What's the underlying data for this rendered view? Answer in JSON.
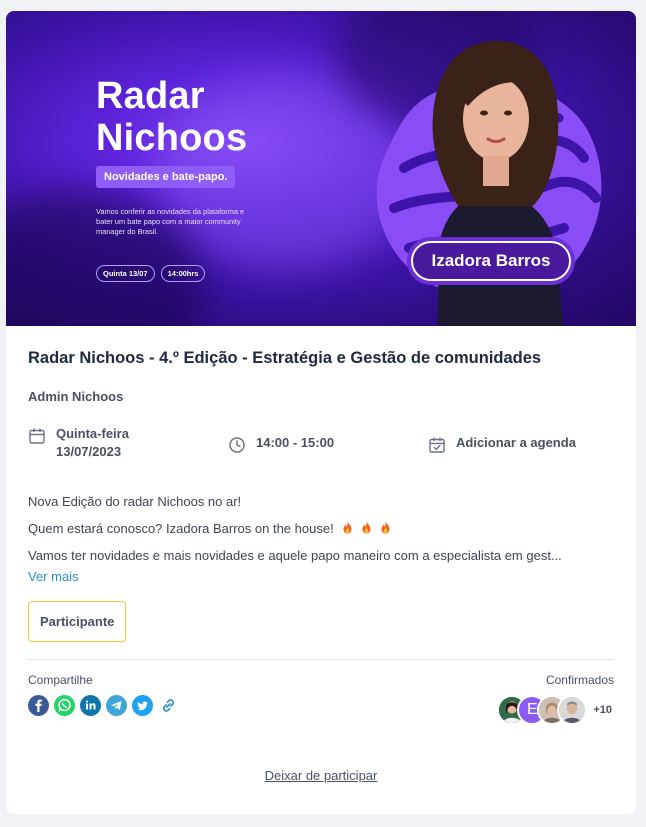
{
  "banner": {
    "title_line1": "Radar",
    "title_line2": "Nichoos",
    "subtitle": "Novidades e bate-papo.",
    "description": "Vamos conferir as novidades da plataforma e bater um bate papo com a maior community manager do Brasil.",
    "day_pill": "Quinta 13/07",
    "time_pill": "14:00hrs",
    "speaker_name": "Izadora Barros"
  },
  "event": {
    "title": "Radar Nichoos - 4.º Edição - Estratégia e Gestão de comunidades",
    "author": "Admin Nichoos",
    "weekday": "Quinta-feira",
    "date": "13/07/2023",
    "time": "14:00 - 15:00",
    "add_calendar": "Adicionar a agenda"
  },
  "description": {
    "line1": "Nova Edição do radar Nichoos no ar!",
    "line2": "Quem estará conosco? Izadora Barros on the house!",
    "line3": "Vamos ter novidades e mais novidades e aquele papo maneiro com a especialista em gest...",
    "see_more": "Ver mais"
  },
  "participant_button": "Participante",
  "share": {
    "label": "Compartilhe",
    "icons": [
      "facebook-icon",
      "whatsapp-icon",
      "linkedin-icon",
      "telegram-icon",
      "twitter-icon",
      "link-icon"
    ]
  },
  "confirmed": {
    "label": "Confirmados",
    "avatar_letter": "E",
    "extra_count": "+10"
  },
  "leave_link": "Deixar de participar",
  "colors": {
    "banner_purple": "#3c13a6",
    "accent_purple": "#8e5cf6",
    "button_border": "#e6c93a",
    "link_blue": "#2a8fc9"
  }
}
